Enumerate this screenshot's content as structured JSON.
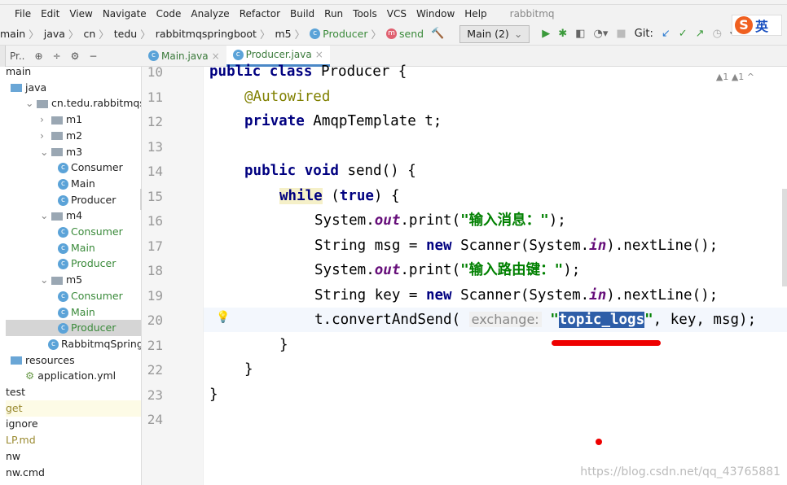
{
  "menu": {
    "items": [
      "File",
      "Edit",
      "View",
      "Navigate",
      "Code",
      "Analyze",
      "Refactor",
      "Build",
      "Run",
      "Tools",
      "VCS",
      "Window",
      "Help"
    ],
    "project": "rabbitmq"
  },
  "breadcrumb": [
    "main",
    "java",
    "cn",
    "tedu",
    "rabbitmqspringboot",
    "m5",
    "Producer",
    "send"
  ],
  "run_config": "Main (2)",
  "git_label": "Git:",
  "ime": {
    "logo": "S",
    "lang": "英"
  },
  "project_panel": {
    "label": "Pr.."
  },
  "tabs": [
    {
      "label": "Main.java",
      "close": "×"
    },
    {
      "label": "Producer.java",
      "close": "×"
    }
  ],
  "tree": [
    "main",
    "java",
    "cn.tedu.rabbitmqsprin",
    "m1",
    "m2",
    "m3",
    "Consumer",
    "Main",
    "Producer",
    "m4",
    "Consumer",
    "Main",
    "Producer",
    "m5",
    "Consumer",
    "Main",
    "Producer",
    "RabbitmqSpringbo",
    "resources",
    "application.yml",
    "test",
    "get",
    "ignore",
    "LP.md",
    "nw",
    "nw.cmd"
  ],
  "inspections": "▲1 ▲1 ^",
  "code": {
    "line_numbers": [
      "10",
      "11",
      "12",
      "13",
      "14",
      "15",
      "16",
      "17",
      "18",
      "19",
      "20",
      "21",
      "22",
      "23",
      "24"
    ],
    "l10": [
      "public class",
      " Producer {"
    ],
    "l11": "@Autowired",
    "l12": [
      "private",
      " AmqpTemplate t;"
    ],
    "l14": [
      "public void",
      " send() {"
    ],
    "l15": [
      "while",
      " (",
      "true",
      ") {"
    ],
    "l16": [
      "System.",
      "out",
      ".print(",
      "\"输入消息：\"",
      ");"
    ],
    "l17": [
      "String msg = ",
      "new",
      " Scanner(System.",
      "in",
      ").nextLine();"
    ],
    "l18": [
      "System.",
      "out",
      ".print(",
      "\"输入路由键：\"",
      ");"
    ],
    "l19": [
      "String key = ",
      "new",
      " Scanner(System.",
      "in",
      ").nextLine();"
    ],
    "l20": [
      "t.convertAndSend( ",
      "exchange:",
      " \"",
      "topic_logs",
      "\"",
      ", key, msg);"
    ],
    "l21": "}",
    "l22": "}",
    "l23": "}"
  },
  "watermark": "https://blog.csdn.net/qq_43765881"
}
